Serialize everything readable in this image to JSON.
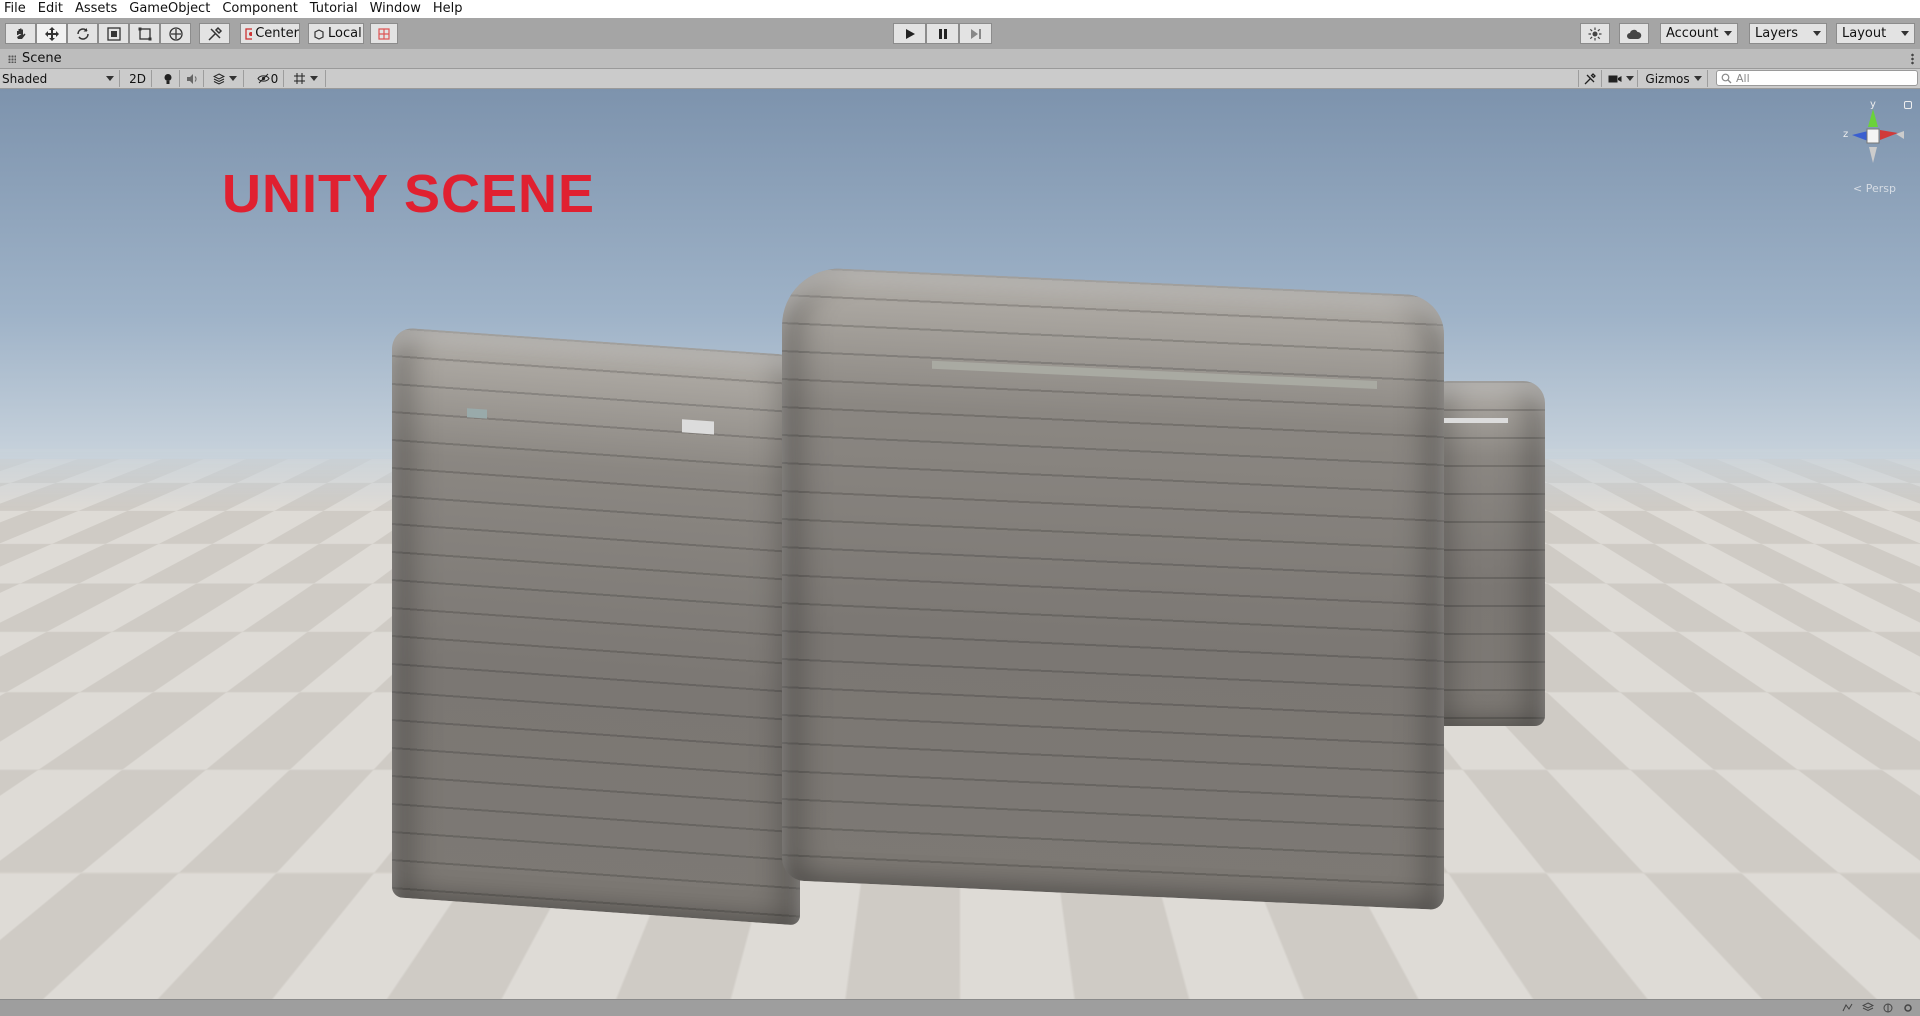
{
  "menu": [
    "File",
    "Edit",
    "Assets",
    "GameObject",
    "Component",
    "Tutorial",
    "Window",
    "Help"
  ],
  "toolbar": {
    "tools": [
      "hand-tool-icon",
      "move-tool-icon",
      "rotate-tool-icon",
      "scale-tool-icon",
      "rect-tool-icon",
      "transform-tool-icon",
      "custom-tool-icon"
    ],
    "pivot_label": "Center",
    "space_label": "Local",
    "account_label": "Account",
    "layers_label": "Layers",
    "layout_label": "Layout"
  },
  "tab": {
    "label": "Scene"
  },
  "scene_toolbar": {
    "draw_mode": "Shaded",
    "mode_2d": "2D",
    "hidden_count": "0",
    "gizmos_label": "Gizmos",
    "search_placeholder": "All"
  },
  "viewport": {
    "overlay_text": "UNITY SCENE",
    "projection_label": "Persp",
    "gizmo_axes": {
      "y": "y",
      "z": "z",
      "x": "x"
    },
    "accent_red": "#e02030"
  }
}
